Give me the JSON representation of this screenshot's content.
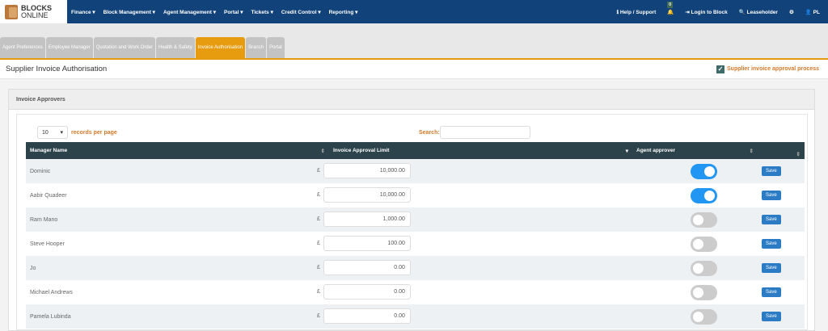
{
  "brand": {
    "line1": "BLOCKS",
    "line2": "ONLINE"
  },
  "nav": {
    "menu": [
      "Finance ▾",
      "Block Management ▾",
      "Agent Management ▾",
      "Portal ▾",
      "Tickets ▾",
      "Credit Control ▾",
      "Reporting ▾"
    ],
    "help": "ℹ Help / Support",
    "notifications": "0",
    "login": "⇥ Login to Block",
    "leaseholder": "🔍 Leaseholder",
    "settings": "⚙",
    "user": "👤 PL"
  },
  "tabs": [
    "Agent Preferences",
    "Employee Manager",
    "Quotation and Work Order",
    "Health & Safety",
    "Invoice Authorisation",
    "Branch",
    "Portal"
  ],
  "active_tab": 4,
  "page": {
    "title": "Supplier Invoice Authorisation",
    "checkbox_label": "Supplier invoice approval process",
    "checkbox_checked": true
  },
  "panel": {
    "title": "Invoice Approvers",
    "page_size": "10",
    "records_label": "records per page",
    "search_label": "Search:",
    "search_value": ""
  },
  "table": {
    "headers": [
      "Manager Name",
      "Invoice Approval Limit",
      "Agent approver",
      ""
    ],
    "currency": "£",
    "save_label": "Save",
    "rows": [
      {
        "name": "Dominic",
        "limit": "10,000.00",
        "approver": true
      },
      {
        "name": "Aabir Quadeer",
        "limit": "10,000.00",
        "approver": true
      },
      {
        "name": "Ram Mano",
        "limit": "1,000.00",
        "approver": false
      },
      {
        "name": "Steve Hooper",
        "limit": "100.00",
        "approver": false
      },
      {
        "name": "Jo",
        "limit": "0.00",
        "approver": false
      },
      {
        "name": "Michael Andrews",
        "limit": "0.00",
        "approver": false
      },
      {
        "name": "Pamela Lubinda",
        "limit": "0.00",
        "approver": false
      }
    ]
  }
}
